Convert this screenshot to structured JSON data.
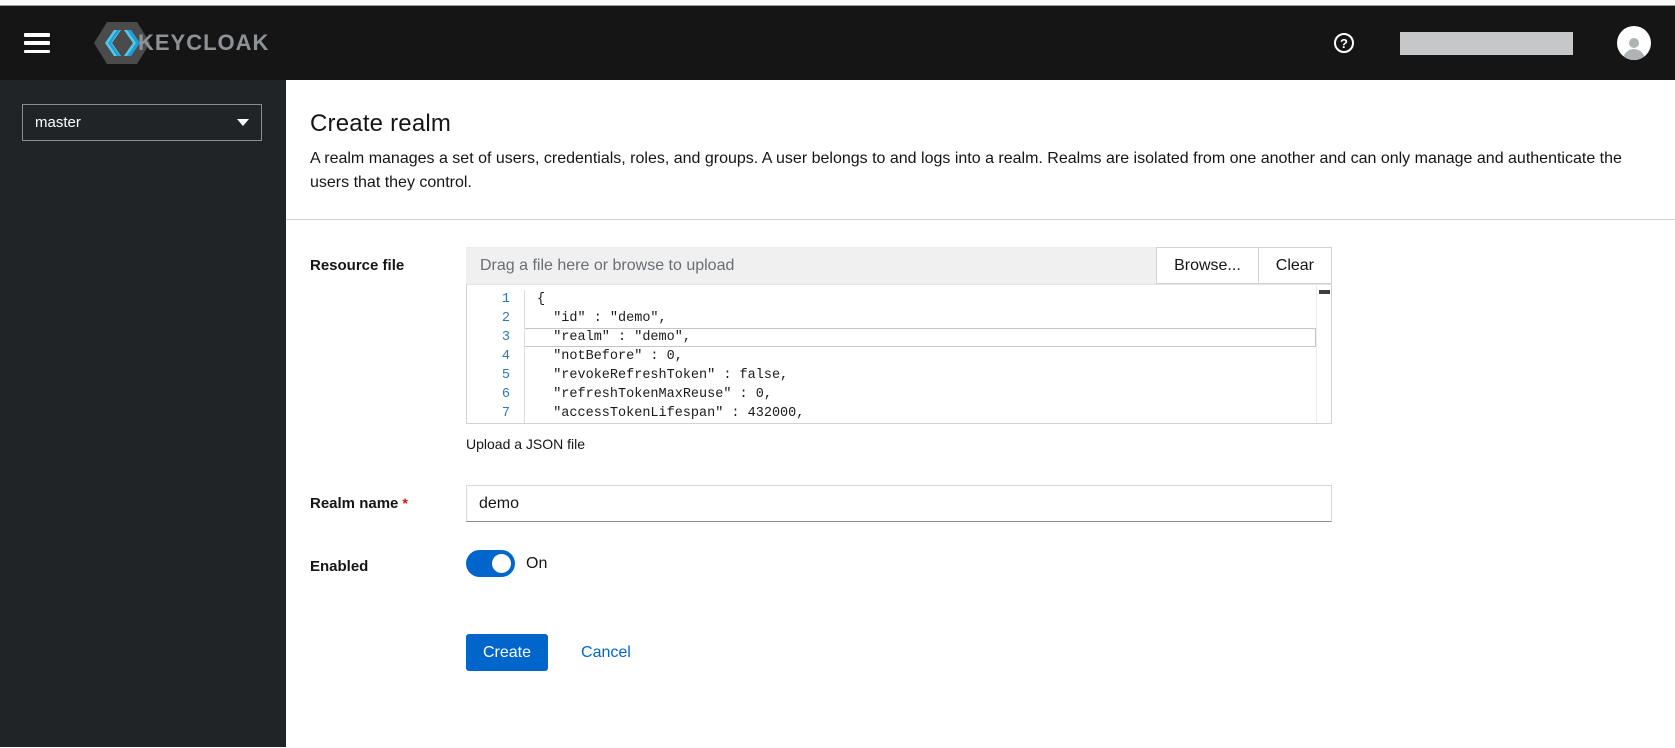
{
  "navbar": {
    "brand": "KEYCLOAK"
  },
  "sidebar": {
    "realm_selector": "master"
  },
  "page": {
    "title": "Create realm",
    "description": "A realm manages a set of users, credentials, roles, and groups. A user belongs to and logs into a realm. Realms are isolated from one another and can only manage and authenticate the users that they control."
  },
  "form": {
    "resource_file": {
      "label": "Resource file",
      "placeholder": "Drag a file here or browse to upload",
      "browse_label": "Browse...",
      "clear_label": "Clear",
      "helper": "Upload a JSON file",
      "editor_lines": [
        {
          "num": "1",
          "text": "{"
        },
        {
          "num": "2",
          "text": "  \"id\" : \"demo\","
        },
        {
          "num": "3",
          "text": "  \"realm\" : \"demo\",",
          "active": true
        },
        {
          "num": "4",
          "text": "  \"notBefore\" : 0,"
        },
        {
          "num": "5",
          "text": "  \"revokeRefreshToken\" : false,"
        },
        {
          "num": "6",
          "text": "  \"refreshTokenMaxReuse\" : 0,"
        },
        {
          "num": "7",
          "text": "  \"accessTokenLifespan\" : 432000,"
        }
      ]
    },
    "realm_name": {
      "label": "Realm name",
      "required_marker": "*",
      "value": "demo"
    },
    "enabled": {
      "label": "Enabled",
      "state_label": "On",
      "on": true
    },
    "actions": {
      "create_label": "Create",
      "cancel_label": "Cancel"
    }
  },
  "colors": {
    "accent": "#0066cc",
    "navbar_bg": "#151515",
    "sidebar_bg": "#212427",
    "required": "#c9190b",
    "line_number_blue": "#2b7bb9"
  }
}
